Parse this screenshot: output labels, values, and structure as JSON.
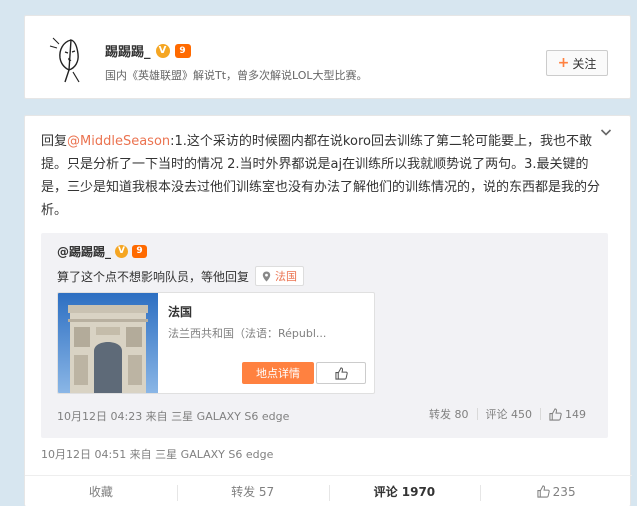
{
  "profile": {
    "name": "踢踢踢_",
    "verify_badge": "V",
    "level_badge": "9",
    "bio": "国内《英雄联盟》解说Tt，曾多次解说LOL大型比赛。",
    "follow_label": "关注",
    "follow_icon": "plus-icon"
  },
  "comment": {
    "reply_prefix": "回复",
    "mention": "@MiddleSeason",
    "body": ":1.这个采访的时候圈内都在说koro回去训练了第二轮可能要上，我也不敢提。只是分析了一下当时的情况 2.当时外界都说是aj在训练所以我就顺势说了两句。3.最关键的是，三少是知道我根本没去过他们训练室也没有办法了解他们的训练情况的，说的东西都是我的分析。",
    "meta": "10月12日 04:51 来自 三星 GALAXY S6 edge"
  },
  "quote": {
    "author": "@踢踢踢_",
    "verify_badge": "V",
    "level_badge": "9",
    "text": "算了这个点不想影响队员，等他回复",
    "location_label": "法国",
    "place": {
      "title": "法国",
      "description": "法兰西共和国（法语：Républ...",
      "detail_button": "地点详情"
    },
    "meta": "10月12日 04:23 来自 三星 GALAXY S6 edge",
    "repost_label": "转发 80",
    "comment_label": "评论 450",
    "like_count": "149"
  },
  "action_bar": {
    "favorite": "收藏",
    "repost": "转发 57",
    "comment": "评论 1970",
    "like": "235"
  },
  "colors": {
    "accent_orange": "#eb7350",
    "button_orange": "#ff8140",
    "badge_yellow": "#f5a623",
    "background": "#d7e6f0"
  }
}
